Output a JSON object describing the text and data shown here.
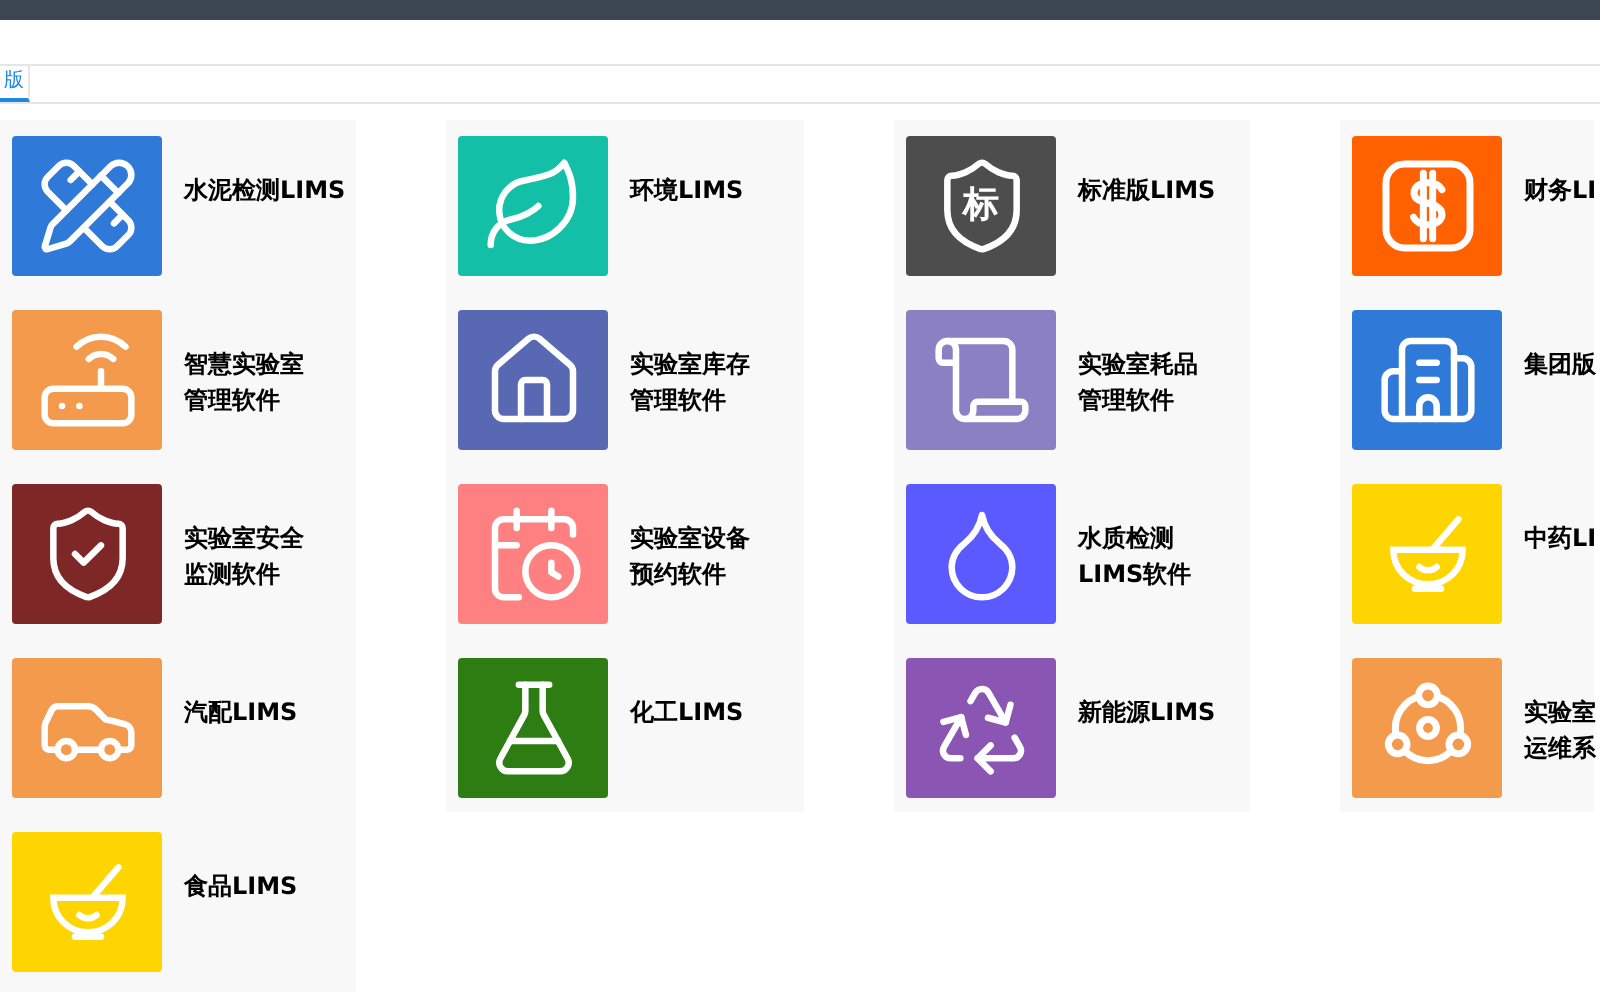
{
  "tabs": [
    {
      "label": "版",
      "selected": true
    }
  ],
  "columns": [
    {
      "items": [
        {
          "lines": [
            "水泥检测LIMS"
          ],
          "color": "#2f7ad9"
        },
        {
          "lines": [
            "智慧实验室",
            "管理软件"
          ],
          "color": "#f39a4c"
        },
        {
          "lines": [
            "实验室安全",
            "监测软件"
          ],
          "color": "#7d2727"
        },
        {
          "lines": [
            "汽配LIMS"
          ],
          "color": "#f39a4c"
        },
        {
          "lines": [
            "食品LIMS"
          ],
          "color": "#ffd500"
        }
      ]
    },
    {
      "items": [
        {
          "lines": [
            "环境LIMS"
          ],
          "color": "#14bfa8"
        },
        {
          "lines": [
            "实验室库存",
            "管理软件"
          ],
          "color": "#5868b3"
        },
        {
          "lines": [
            "实验室设备",
            "预约软件"
          ],
          "color": "#ff8080"
        },
        {
          "lines": [
            "化工LIMS"
          ],
          "color": "#2d7d12"
        }
      ]
    },
    {
      "items": [
        {
          "lines": [
            "标准版LIMS"
          ],
          "color": "#4d4d4d",
          "badge": "标"
        },
        {
          "lines": [
            "实验室耗品",
            "管理软件"
          ],
          "color": "#8b80c3"
        },
        {
          "lines": [
            "水质检测",
            "LIMS软件"
          ],
          "color": "#5a5aff"
        },
        {
          "lines": [
            "新能源LIMS"
          ],
          "color": "#8a55b3"
        }
      ]
    },
    {
      "items": [
        {
          "lines": [
            "财务LI"
          ],
          "color": "#ff6000"
        },
        {
          "lines": [
            "集团版"
          ],
          "color": "#2f7ad9"
        },
        {
          "lines": [
            "中药LI"
          ],
          "color": "#ffd500"
        },
        {
          "lines": [
            "实验室",
            "运维系"
          ],
          "color": "#f39a4c"
        }
      ]
    }
  ]
}
